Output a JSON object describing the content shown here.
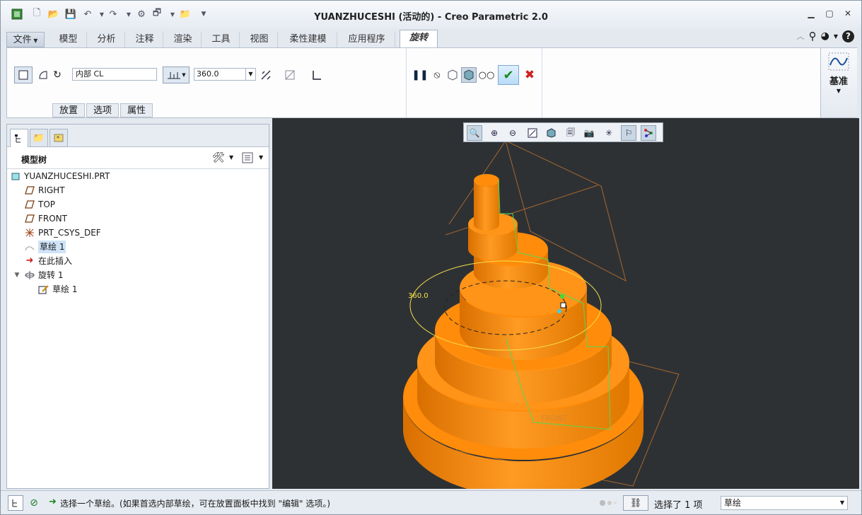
{
  "window": {
    "title": "YUANZHUCESHI (活动的) - Creo Parametric 2.0"
  },
  "tabs": [
    "文件",
    "模型",
    "分析",
    "注释",
    "渲染",
    "工具",
    "视图",
    "柔性建模",
    "应用程序",
    "旋转"
  ],
  "ribbon": {
    "reference_value": "内部 CL",
    "angle_value": "360.0",
    "datum_label": "基准",
    "subtabs": [
      "放置",
      "选项",
      "属性"
    ]
  },
  "model_tree": {
    "title": "模型树",
    "items": [
      {
        "label": "YUANZHUCESHI.PRT",
        "icon": "part-icon",
        "indent": 0
      },
      {
        "label": "RIGHT",
        "icon": "datum-plane-icon",
        "indent": 1
      },
      {
        "label": "TOP",
        "icon": "datum-plane-icon",
        "indent": 1
      },
      {
        "label": "FRONT",
        "icon": "datum-plane-icon",
        "indent": 1
      },
      {
        "label": "PRT_CSYS_DEF",
        "icon": "csys-icon",
        "indent": 1
      },
      {
        "label": "草绘 1",
        "icon": "sketch-icon",
        "indent": 1
      },
      {
        "label": "在此插入",
        "icon": "insert-arrow-icon",
        "indent": 1
      },
      {
        "label": "旋转 1",
        "icon": "revolve-icon",
        "indent": 1
      },
      {
        "label": "草绘 1",
        "icon": "sketch-edit-icon",
        "indent": 2
      }
    ]
  },
  "viewport": {
    "angle_label": "360.0",
    "plane_label": "FRONT",
    "model_color": "#ff8c0a",
    "background": "#2e3134"
  },
  "status": {
    "message": "选择一个草绘。(如果首选内部草绘，可在放置面板中找到 \"编辑\" 选项。)",
    "selection": "选择了 1 项",
    "filter": "草绘"
  }
}
